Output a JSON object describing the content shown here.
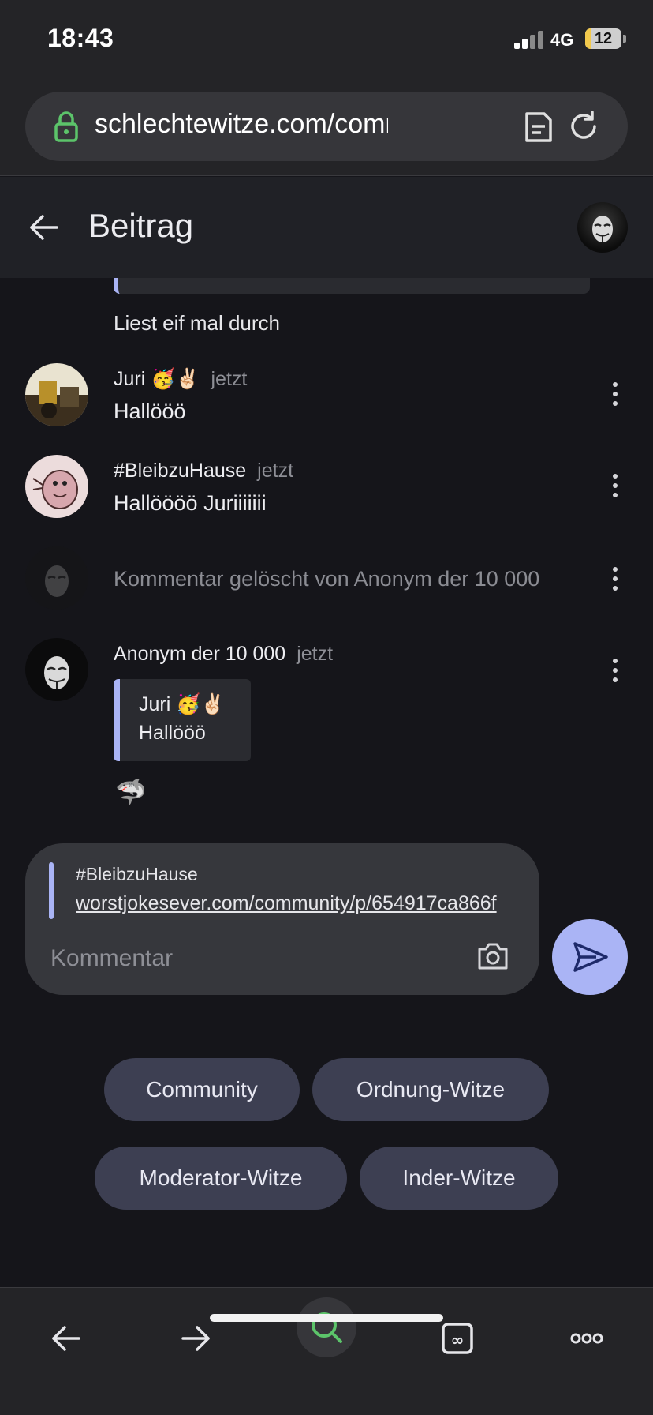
{
  "status_bar": {
    "time": "18:43",
    "network": "4G",
    "battery_level": "12",
    "battery_fraction": 0.12
  },
  "browser": {
    "url": "schlechtewitze.com/community/...",
    "icons": [
      "lock-icon",
      "reader-mode-icon",
      "reload-icon"
    ]
  },
  "header": {
    "title": "Beitrag"
  },
  "feed": {
    "previous_comment_text": "Liest eif mal durch",
    "comments": [
      {
        "author": "Juri 🥳✌🏻",
        "time": "jetzt",
        "body": "Hallööö"
      },
      {
        "author": "#BleibzuHause",
        "time": "jetzt",
        "body": "Hallöööö Juriiiiiii"
      },
      {
        "deleted_text": "Kommentar gelöscht von Anonym der 10 000"
      },
      {
        "author": "Anonym der 10 000",
        "time": "jetzt",
        "quote": {
          "author": "Juri 🥳✌🏻",
          "body": "Hallööö"
        },
        "body": "🦈"
      }
    ]
  },
  "composer": {
    "reply_to": "#BleibzuHause",
    "reply_link": "worstjokesever.com/community/p/654917ca866f",
    "placeholder": "Kommentar"
  },
  "chips": [
    "Community",
    "Ordnung-Witze",
    "Moderator-Witze",
    "Inder-Witze"
  ],
  "colors": {
    "accent": "#aab4f5",
    "background": "#15151a",
    "chip": "#3d3f52",
    "search_green": "#5cc46a"
  }
}
